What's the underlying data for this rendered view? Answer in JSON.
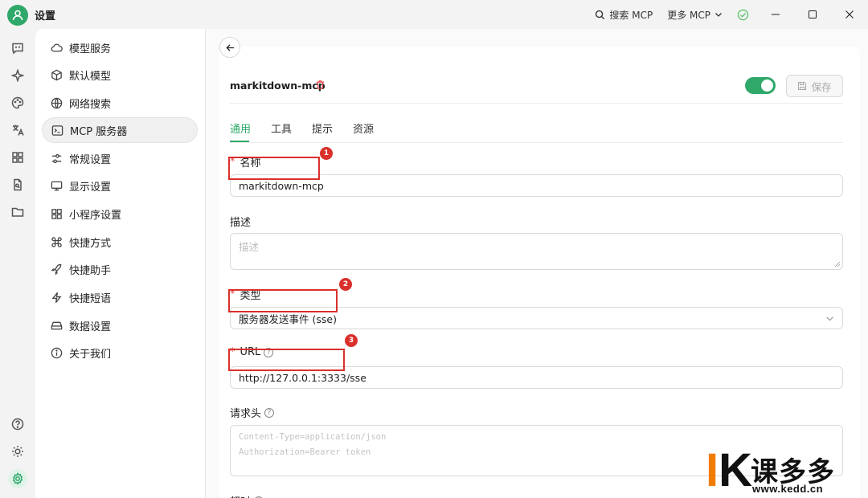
{
  "titlebar": {
    "title": "设置",
    "search_mcp": "搜索 MCP",
    "more_mcp": "更多 MCP"
  },
  "menu": {
    "items": [
      {
        "label": "模型服务",
        "icon": "cloud-icon"
      },
      {
        "label": "默认模型",
        "icon": "cube-icon"
      },
      {
        "label": "网络搜索",
        "icon": "globe-icon"
      },
      {
        "label": "MCP 服务器",
        "icon": "terminal-icon"
      },
      {
        "label": "常规设置",
        "icon": "sliders-icon"
      },
      {
        "label": "显示设置",
        "icon": "monitor-icon"
      },
      {
        "label": "小程序设置",
        "icon": "grid-icon"
      },
      {
        "label": "快捷方式",
        "icon": "command-icon"
      },
      {
        "label": "快捷助手",
        "icon": "rocket-icon"
      },
      {
        "label": "快捷短语",
        "icon": "zap-icon"
      },
      {
        "label": "数据设置",
        "icon": "drive-icon"
      },
      {
        "label": "关于我们",
        "icon": "info-icon"
      }
    ],
    "active_index": 3
  },
  "server": {
    "name": "markitdown-mcp",
    "enabled": true,
    "save_label": "保存"
  },
  "tabs": [
    "通用",
    "工具",
    "提示",
    "资源"
  ],
  "form": {
    "name_label": "名称",
    "name_value": "markitdown-mcp",
    "desc_label": "描述",
    "desc_placeholder": "描述",
    "type_label": "类型",
    "type_value": "服务器发送事件 (sse)",
    "url_label": "URL",
    "url_value": "http://127.0.0.1:3333/sse",
    "headers_label": "请求头",
    "headers_placeholder_1": "Content-Type=application/json",
    "headers_placeholder_2": "Authorization=Bearer token",
    "timeout_label": "超时"
  },
  "annotations": [
    "1",
    "2",
    "3"
  ],
  "watermark": {
    "brand": "课多多",
    "url": "www.kedd.cn"
  },
  "colors": {
    "accent": "#2fa86a",
    "annotation_red": "#d9302c"
  }
}
